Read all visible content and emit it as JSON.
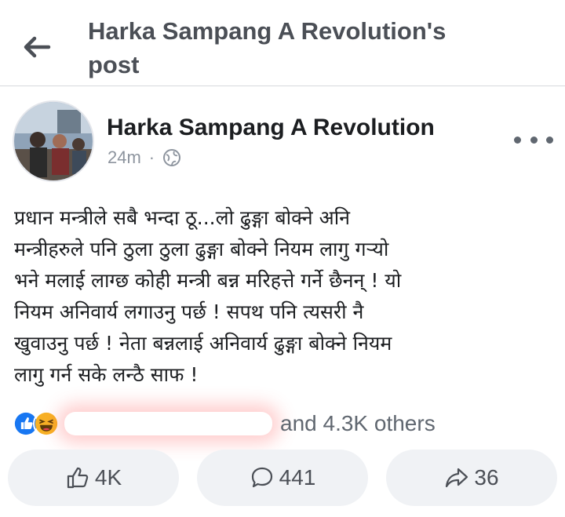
{
  "header": {
    "title": "Harka Sampang A Revolution's post",
    "back_icon": "arrow-left-icon"
  },
  "post": {
    "author": "Harka Sampang A Revolution",
    "time": "24m",
    "separator": "·",
    "privacy_icon": "globe-icon",
    "more_icon": "more-dots-icon",
    "text_lines": [
      "प्रधान मन्त्रीले सबै भन्दा ठू...लो ढुङ्गा बोक्ने अनि",
      "मन्त्रीहरुले पनि ठुला ठुला ढुङ्गा बोक्ने नियम लागु गऱ्यो",
      "भने मलाई लाग्छ कोही मन्त्री बन्न मरिहत्ते गर्ने छैनन् ! यो",
      "नियम अनिवार्य लगाउनु पर्छ ! सपथ पनि त्यसरी नै",
      "खुवाउनु पर्छ ! नेता बन्नलाई अनिवार्य ढुङ्गा बोक्ने नियम",
      "लागु गर्न सके लन्ठै साफ !"
    ]
  },
  "reactions": {
    "icons": [
      "like-reaction-icon",
      "haha-reaction-icon"
    ],
    "summary": "and 4.3K others"
  },
  "actions": {
    "like_count": "4K",
    "comment_count": "441",
    "share_count": "36"
  },
  "colors": {
    "facebook_blue": "#1877f2",
    "haha_yellow": "#f7b125",
    "text_gray": "#606770",
    "button_bg": "#f0f2f5"
  }
}
